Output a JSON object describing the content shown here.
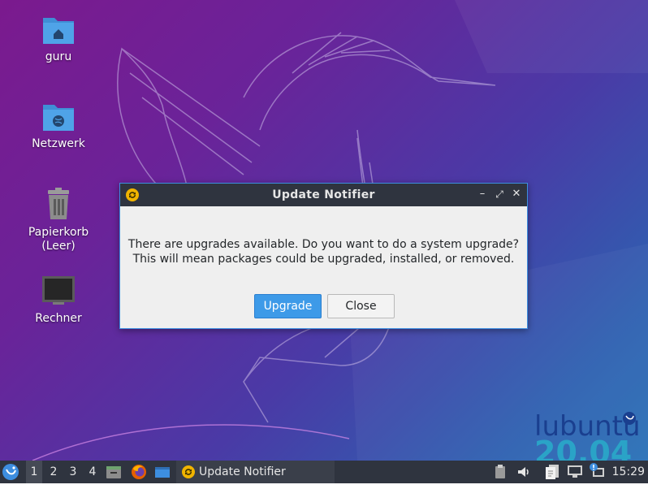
{
  "desktop": {
    "icons": [
      {
        "label": "guru"
      },
      {
        "label": "Netzwerk"
      },
      {
        "label": "Papierkorb (Leer)"
      },
      {
        "label": "Rechner"
      }
    ],
    "brand": {
      "name": "lubuntu",
      "version": "20.04"
    }
  },
  "dialog": {
    "title": "Update Notifier",
    "message_line1": "There are upgrades available. Do you want to do a system upgrade?",
    "message_line2": "This will mean packages could be upgraded, installed, or removed.",
    "upgrade_label": "Upgrade",
    "close_label": "Close",
    "minimize_glyph": "–",
    "maximize_glyph": "⤢",
    "close_glyph": "✕"
  },
  "taskbar": {
    "desktops": [
      "1",
      "2",
      "3",
      "4"
    ],
    "active_desktop": "1",
    "task_label": "Update Notifier",
    "clock": "15:29"
  },
  "colors": {
    "accent": "#3d9ae8",
    "titlebar": "#2f343f",
    "updater_icon": "#f0b400",
    "brand_blue": "#1a3f8f",
    "brand_teal": "#2aa3c7"
  }
}
